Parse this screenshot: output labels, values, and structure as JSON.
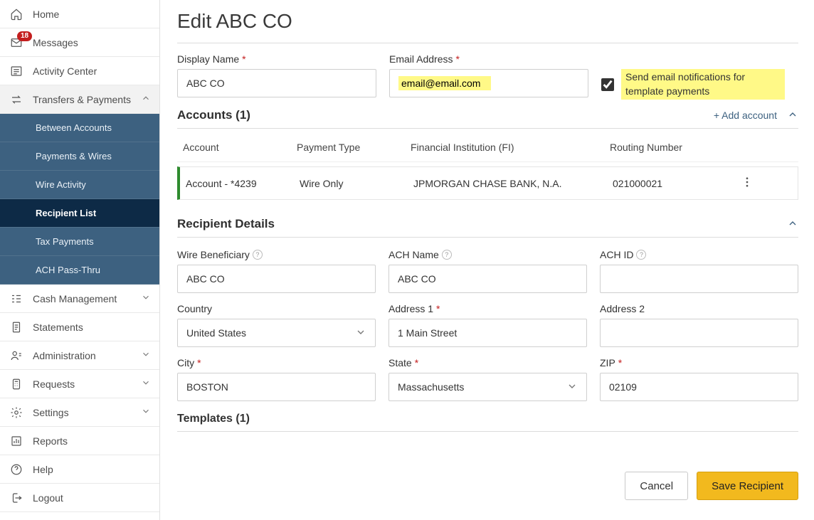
{
  "sidebar": {
    "home": "Home",
    "messages": "Messages",
    "messages_badge": "18",
    "activity_center": "Activity Center",
    "transfers_payments": "Transfers & Payments",
    "sub": {
      "between_accounts": "Between Accounts",
      "payments_wires": "Payments & Wires",
      "wire_activity": "Wire Activity",
      "recipient_list": "Recipient List",
      "tax_payments": "Tax Payments",
      "ach_pass_thru": "ACH Pass-Thru"
    },
    "cash_management": "Cash Management",
    "statements": "Statements",
    "administration": "Administration",
    "requests": "Requests",
    "settings": "Settings",
    "reports": "Reports",
    "help": "Help",
    "logout": "Logout"
  },
  "page": {
    "title": "Edit ABC CO",
    "display_name_label": "Display Name",
    "display_name_value": "ABC CO",
    "email_label": "Email Address",
    "email_value": "email@email.com",
    "checkbox_label": "Send email notifications for template payments",
    "checkbox_checked": true
  },
  "accounts": {
    "heading": "Accounts (1)",
    "add_account": "+ Add account",
    "columns": {
      "account": "Account",
      "payment_type": "Payment Type",
      "fi": "Financial Institution (FI)",
      "routing": "Routing Number"
    },
    "row": {
      "account": "Account - *4239",
      "payment_type": "Wire Only",
      "fi": "JPMORGAN CHASE BANK, N.A.",
      "routing": "021000021"
    }
  },
  "details": {
    "heading": "Recipient Details",
    "wire_beneficiary_label": "Wire Beneficiary",
    "wire_beneficiary_value": "ABC CO",
    "ach_name_label": "ACH Name",
    "ach_name_value": "ABC CO",
    "ach_id_label": "ACH ID",
    "ach_id_value": "",
    "country_label": "Country",
    "country_value": "United States",
    "address1_label": "Address 1",
    "address1_value": "1 Main Street",
    "address2_label": "Address 2",
    "address2_value": "",
    "city_label": "City",
    "city_value": "BOSTON",
    "state_label": "State",
    "state_value": "Massachusetts",
    "zip_label": "ZIP",
    "zip_value": "02109"
  },
  "templates": {
    "heading": "Templates (1)"
  },
  "footer": {
    "cancel": "Cancel",
    "save": "Save Recipient"
  }
}
